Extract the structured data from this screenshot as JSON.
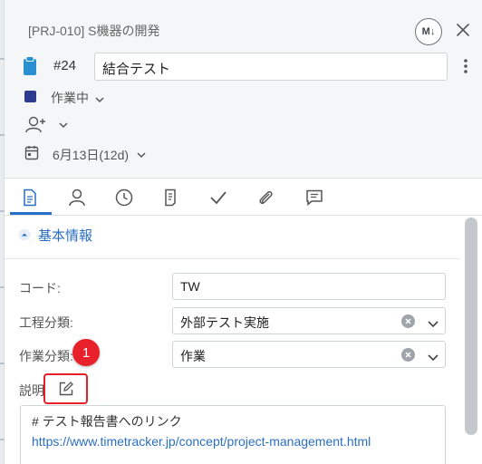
{
  "header": {
    "project": "[PRJ-010] S機器の開発",
    "markdown_label": "M↓",
    "task_number": "#24",
    "task_title": "結合テスト"
  },
  "status": {
    "label": "作業中",
    "color": "#2c3b8f"
  },
  "date": {
    "label": "6月13日(12d)"
  },
  "tabs": [
    {
      "icon": "document-icon",
      "active": true
    },
    {
      "icon": "person-icon"
    },
    {
      "icon": "clock-icon"
    },
    {
      "icon": "notes-icon"
    },
    {
      "icon": "check-icon"
    },
    {
      "icon": "paperclip-icon"
    },
    {
      "icon": "comment-icon"
    }
  ],
  "section": {
    "label": "基本情報"
  },
  "fields": {
    "code": {
      "label": "コード:",
      "value": "TW"
    },
    "process": {
      "label": "工程分類:",
      "value": "外部テスト実施"
    },
    "work": {
      "label": "作業分類:",
      "value": "作業"
    },
    "description": {
      "label": "説明:"
    }
  },
  "badge": {
    "number": "1"
  },
  "description": {
    "heading": "# テスト報告書へのリンク",
    "link": "https://www.timetracker.jp/concept/project-management.html"
  },
  "colors": {
    "accent": "#2a6fc1",
    "badge": "#e8202a"
  }
}
